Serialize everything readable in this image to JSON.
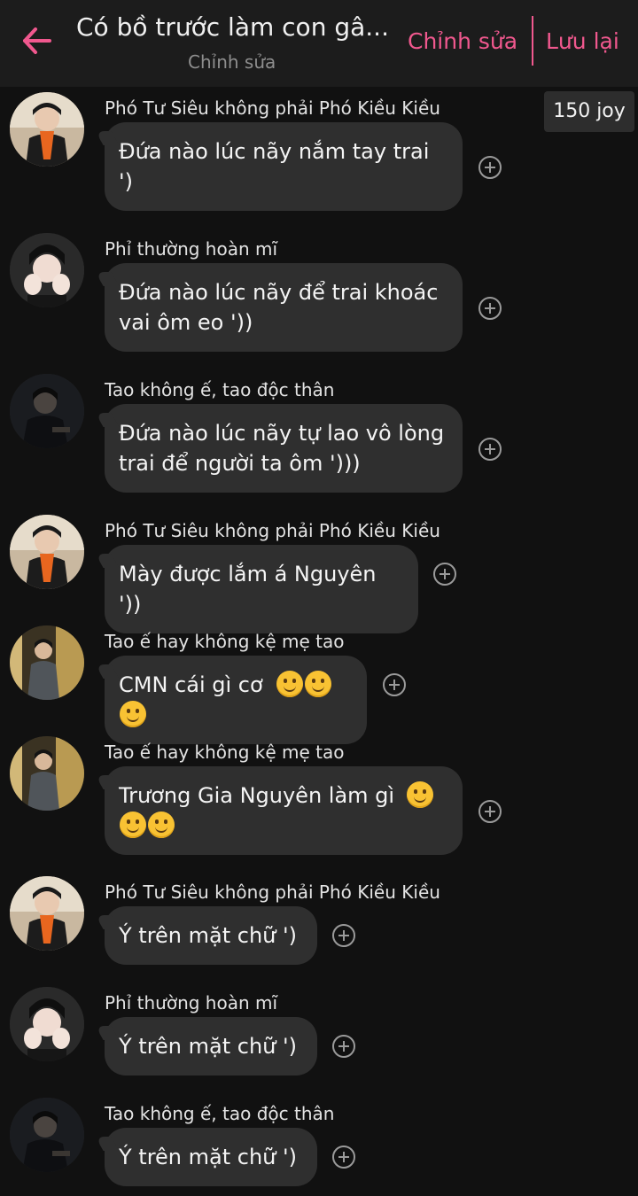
{
  "header": {
    "title": "Có bồ trước làm con gâ...",
    "subtitle": "Chỉnh sửa",
    "edit_label": "Chỉnh sửa",
    "save_label": "Lưu lại",
    "accent_color": "#f0588e"
  },
  "joy_badge": "150 joy",
  "messages": [
    {
      "sender": "Phó Tư Siêu không phải Phó Kiều Kiều",
      "avatar": "orange-scarf-avatar",
      "text_lines": [
        "Đứa nào lúc nãy nắm tay trai",
        "')"
      ],
      "emoji_count": 0
    },
    {
      "sender": "Phỉ thường hoàn mĩ",
      "avatar": "hands-on-face-avatar",
      "text_lines": [
        "Đứa nào lúc nãy để trai khoác",
        "vai ôm eo '))"
      ],
      "emoji_count": 0
    },
    {
      "sender": "Tao không ế, tao độc thân",
      "avatar": "dark-portrait-avatar",
      "text_lines": [
        "Đứa nào lúc nãy tự lao vô lòng",
        "trai để người ta ôm ')))"
      ],
      "emoji_count": 0
    },
    {
      "sender": "Phó Tư Siêu không phải Phó Kiều Kiều",
      "avatar": "orange-scarf-avatar",
      "text_lines": [
        "Mày được lắm á Nguyên '))"
      ],
      "emoji_count": 0
    },
    {
      "sender": "Tao ế hay không kệ mẹ tao",
      "avatar": "suit-avatar",
      "text_lines": [
        "CMN cái gì cơ"
      ],
      "emoji_count": 3
    },
    {
      "sender": "Tao ế hay không kệ mẹ tao",
      "avatar": "suit-avatar",
      "text_lines": [
        "Trương Gia Nguyên làm gì"
      ],
      "emoji_count": 3
    },
    {
      "sender": "Phó Tư Siêu không phải Phó Kiều Kiều",
      "avatar": "orange-scarf-avatar",
      "text_lines": [
        "Ý trên mặt chữ ')"
      ],
      "emoji_count": 0
    },
    {
      "sender": "Phỉ thường hoàn mĩ",
      "avatar": "hands-on-face-avatar",
      "text_lines": [
        "Ý trên mặt chữ ')"
      ],
      "emoji_count": 0
    },
    {
      "sender": "Tao không ế, tao độc thân",
      "avatar": "dark-portrait-avatar",
      "text_lines": [
        "Ý trên mặt chữ ')"
      ],
      "emoji_count": 0
    }
  ]
}
